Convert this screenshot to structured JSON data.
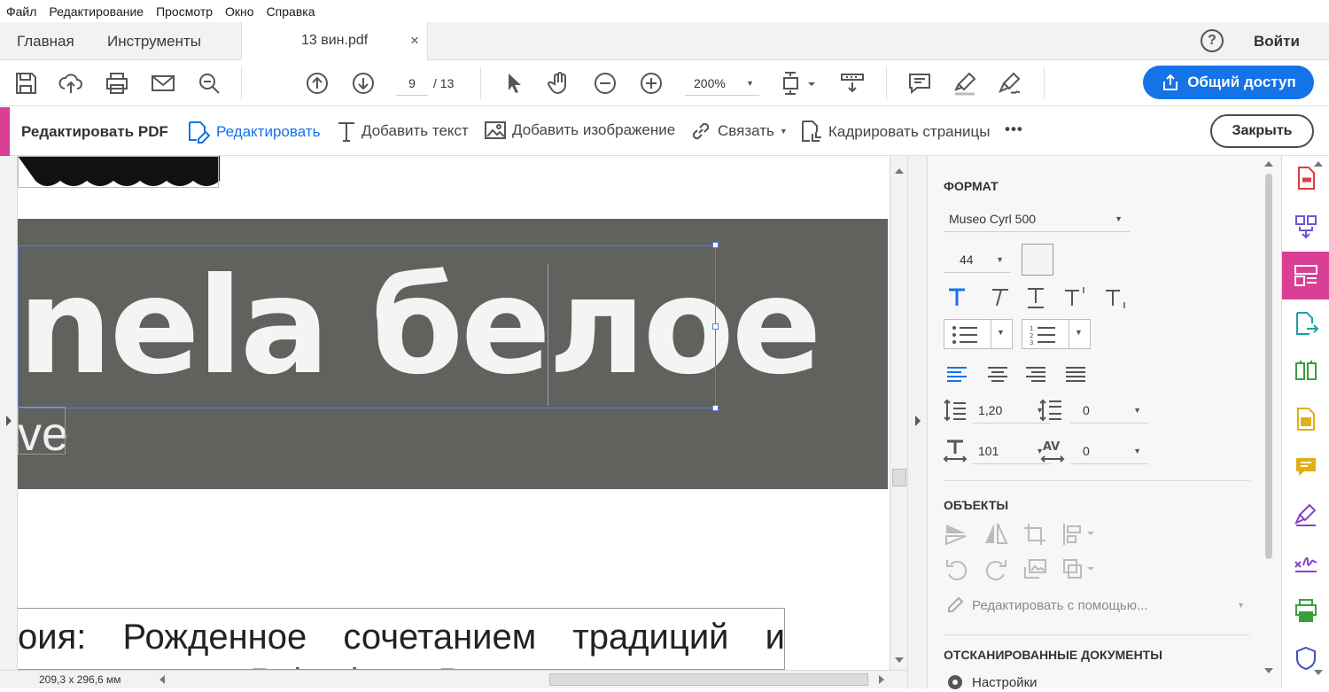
{
  "menu": [
    "Файл",
    "Редактирование",
    "Просмотр",
    "Окно",
    "Справка"
  ],
  "tabs": {
    "home": "Главная",
    "tools": "Инструменты",
    "document": "13 вин.pdf",
    "close_glyph": "×"
  },
  "header": {
    "help_glyph": "?",
    "sign_in": "Войти"
  },
  "toolbar": {
    "current_page": "9",
    "total_pages": "/ 13",
    "zoom": "200%",
    "share_label": "Общий доступ"
  },
  "editbar": {
    "title": "Редактировать PDF",
    "edit": "Редактировать",
    "add_text": "Добавить текст",
    "add_image": "Добавить изображение",
    "link": "Связать",
    "crop": "Кадрировать страницы",
    "more": "•••",
    "close": "Закрыть"
  },
  "document": {
    "big_text": "nela белое",
    "sub_text": "ve",
    "para_line1": [
      "оия:",
      "Рожденное",
      "сочетанием",
      "традиций",
      "и"
    ],
    "para_line2": [
      "…имности",
      "Palmela",
      "Россию",
      "выио",
      "а"
    ]
  },
  "status": {
    "dimensions": "209,3 x 296,6 мм"
  },
  "panel": {
    "format_heading": "ФОРМАТ",
    "font_name": "Museo Cyrl 500",
    "font_size": "44",
    "line_spacing": "1,20",
    "para_spacing": "0",
    "scale": "101",
    "tracking": "0",
    "objects_heading": "ОБЪЕКТЫ",
    "edit_with": "Редактировать с помощью...",
    "scanned_heading": "ОТСКАНИРОВАННЫЕ ДОКУМЕНТЫ",
    "settings": "Настройки"
  },
  "colors": {
    "accent_blue": "#1473e6",
    "edit_pink": "#d93f94",
    "banner_gray": "#5f625d"
  }
}
